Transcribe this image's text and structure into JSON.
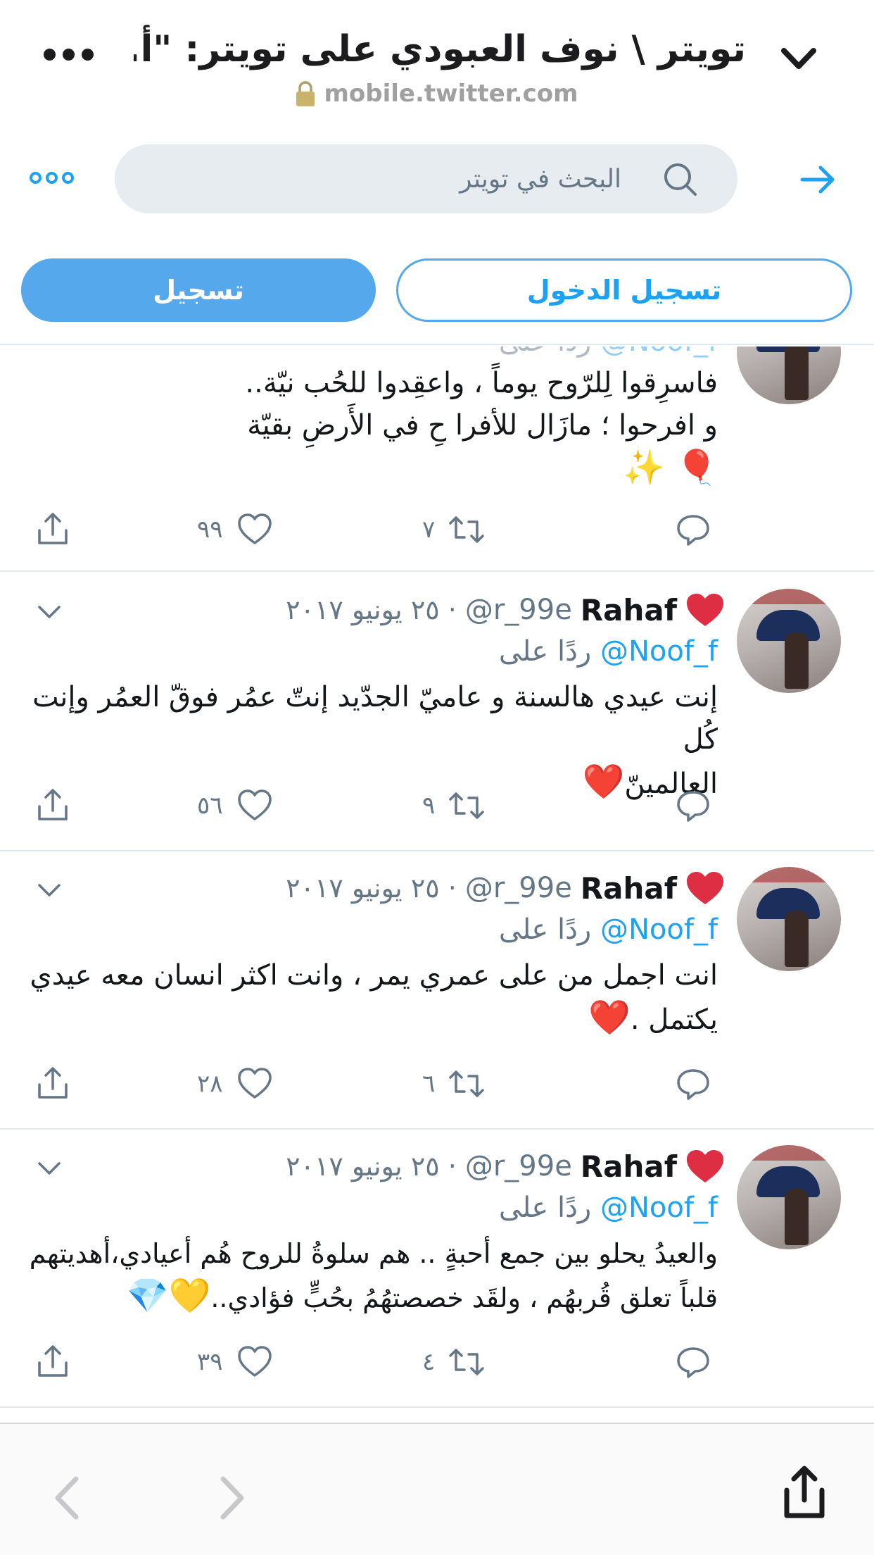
{
  "browser": {
    "title": "تويتر \\ نوف العبودي على تويتر: \"أ...",
    "url": "mobile.twitter.com"
  },
  "twitter": {
    "search_placeholder": "البحث في تويتر",
    "login_label": "تسجيل الدخول",
    "signup_label": "تسجيل",
    "accent": "#1da1f2"
  },
  "tweets": [
    {
      "reply_label": "ردًا على",
      "reply_user": "@Noof_f",
      "lines": [
        "فاسرِقوا لِلرّوح يوماً ، واعقِدوا للحُب نيّة..",
        "و افرحوا ؛ مازَال للأفرا حِ في الأَرضِ بقيّة"
      ],
      "emoji": "🎈 ✨",
      "retweets": "٧",
      "likes": "٩٩"
    },
    {
      "name": "Rahaf",
      "handle": "@r_99e",
      "date": "· ٢٥ يونيو ٢٠١٧",
      "reply_label": "ردًا على",
      "reply_user": "@Noof_f",
      "lines": [
        "إنت عيدي هالسنة و عاميّ الجدّيد إنتّ عمُر فوقّ العمُر وإنت كُل",
        "العالمينّ"
      ],
      "emoji": "❤️",
      "retweets": "٩",
      "likes": "٥٦"
    },
    {
      "name": "Rahaf",
      "handle": "@r_99e",
      "date": "· ٢٥ يونيو ٢٠١٧",
      "reply_label": "ردًا على",
      "reply_user": "@Noof_f",
      "lines": [
        "انت اجمل من على عمري يمر ، وانت اكثر انسان معه عيدي",
        "يكتمل ."
      ],
      "emoji": "❤️",
      "retweets": "٦",
      "likes": "٢٨"
    },
    {
      "name": "Rahaf",
      "handle": "@r_99e",
      "date": "· ٢٥ يونيو ٢٠١٧",
      "reply_label": "ردًا على",
      "reply_user": "@Noof_f",
      "lines": [
        "والعيدُ يحلو بين جمع أحبةٍ .. هم سلوةُ للروح هُم أعيادي،أهديتهم",
        "قلباً تعلق قُربهُم ، ولقَد خصصتهُمُ بحُبٍّ فؤادي.."
      ],
      "emoji": "💛💎",
      "retweets": "٤",
      "likes": "٣٩"
    }
  ]
}
